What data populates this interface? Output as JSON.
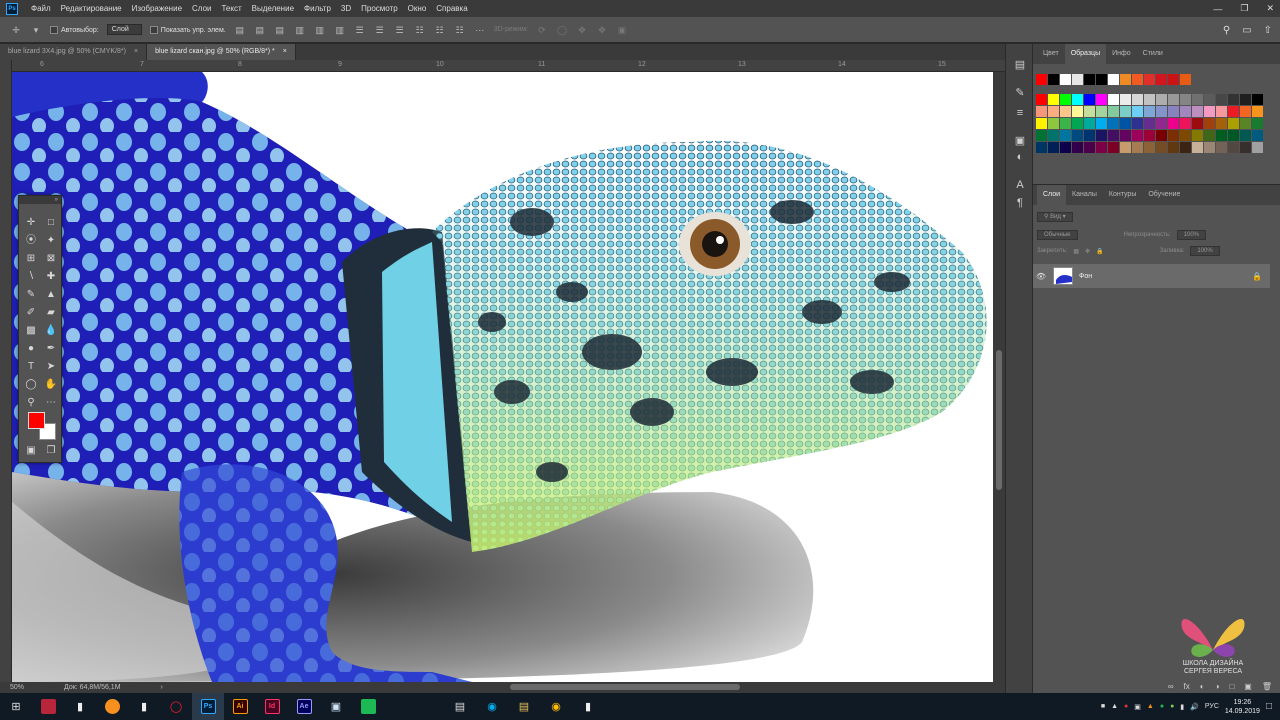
{
  "app": {
    "logo_text": "Ps"
  },
  "menu": [
    "Файл",
    "Редактирование",
    "Изображение",
    "Слои",
    "Текст",
    "Выделение",
    "Фильтр",
    "3D",
    "Просмотр",
    "Окно",
    "Справка"
  ],
  "options": {
    "autoselect_label": "Автовыбор:",
    "autoselect_value": "Слой",
    "show_transform_label": "Показать упр. элем.",
    "mode_3d_label": "3D-режим:"
  },
  "tabs": [
    {
      "label": "blue lizard 3X4.jpg @ 50% (CMYK/8*)",
      "close": "×"
    },
    {
      "label": "blue lizard скан.jpg @ 50% (RGB/8*) *",
      "close": "×"
    }
  ],
  "ruler": {
    "marks": [
      "6",
      "7",
      "8",
      "9",
      "10",
      "11",
      "12",
      "13",
      "14",
      "15"
    ]
  },
  "status": {
    "zoom": "50%",
    "doc": "Док: 64,8M/56,1M",
    "arrow": "›"
  },
  "swatches_panel": {
    "tabs": [
      "Цвет",
      "Образцы",
      "Инфо",
      "Стили"
    ],
    "recent": [
      "#ff0000",
      "#000000",
      "#ffffff",
      "#e6e6e6",
      "#000000",
      "#000000",
      "#ffffff",
      "#f08a24",
      "#f25a24",
      "#e0302c",
      "#d4141e",
      "#c81414",
      "#e65c14"
    ],
    "grid": [
      "#ff0000",
      "#ffff00",
      "#00ff00",
      "#00ffff",
      "#0000ff",
      "#ff00ff",
      "#ffffff",
      "#ebebeb",
      "#d6d6d6",
      "#c2c2c2",
      "#adadad",
      "#999999",
      "#858585",
      "#707070",
      "#5c5c5c",
      "#474747",
      "#333333",
      "#1f1f1f",
      "#000000",
      "#f7977a",
      "#f9ad81",
      "#fdc68a",
      "#fff79a",
      "#c4df9b",
      "#a2d39c",
      "#82ca9d",
      "#7bcdc8",
      "#6ecff6",
      "#7ea7d8",
      "#8493ca",
      "#8882be",
      "#a187be",
      "#bc8dbf",
      "#f49ac2",
      "#f6989d",
      "#ed1c24",
      "#f26522",
      "#f7941d",
      "#fff200",
      "#8dc63f",
      "#39b54a",
      "#00a651",
      "#00a99d",
      "#00aeef",
      "#0072bc",
      "#0054a6",
      "#2e3192",
      "#662d91",
      "#92278f",
      "#ec008c",
      "#ed145b",
      "#9e0b0f",
      "#a0410d",
      "#a36209",
      "#aba000",
      "#598527",
      "#197b30",
      "#007236",
      "#00746b",
      "#0076a3",
      "#004a80",
      "#003471",
      "#1b1464",
      "#440e62",
      "#630460",
      "#9e005d",
      "#9e0039",
      "#790000",
      "#7b2e00",
      "#7d4900",
      "#827b00",
      "#406618",
      "#005e20",
      "#005826",
      "#005952",
      "#005b7f",
      "#003663",
      "#002157",
      "#0d004c",
      "#32004b",
      "#4b0049",
      "#7b0046",
      "#7a0026",
      "#c69c6d",
      "#a67c52",
      "#8c6239",
      "#754c24",
      "#603913",
      "#3c2415",
      "#c7b299",
      "#998675",
      "#736357",
      "#534741",
      "#362f2d",
      "#a0a0a0"
    ]
  },
  "layers_panel": {
    "tabs": [
      "Слои",
      "Каналы",
      "Контуры",
      "Обучение"
    ],
    "filter_label": "Вид",
    "blend_mode": "Обычные",
    "opacity_label": "Непрозрачность:",
    "opacity_value": "100%",
    "lock_label": "Закрепить:",
    "fill_label": "Заливка:",
    "fill_value": "100%",
    "layer_name": "Фон"
  },
  "watermark": {
    "line1": "ШКОЛА ДИЗАЙНА",
    "line2": "СЕРГЕЯ ВЕРЕСА"
  },
  "taskbar": {
    "apps": [
      "Ps",
      "Ai",
      "Id",
      "Ae"
    ],
    "lang": "РУС",
    "time": "19:26",
    "date": "14.09.2019"
  },
  "colors": {
    "foreground": "#ff0000",
    "background": "#ffffff",
    "panel": "#535353",
    "menubar": "#3a3a3a"
  }
}
